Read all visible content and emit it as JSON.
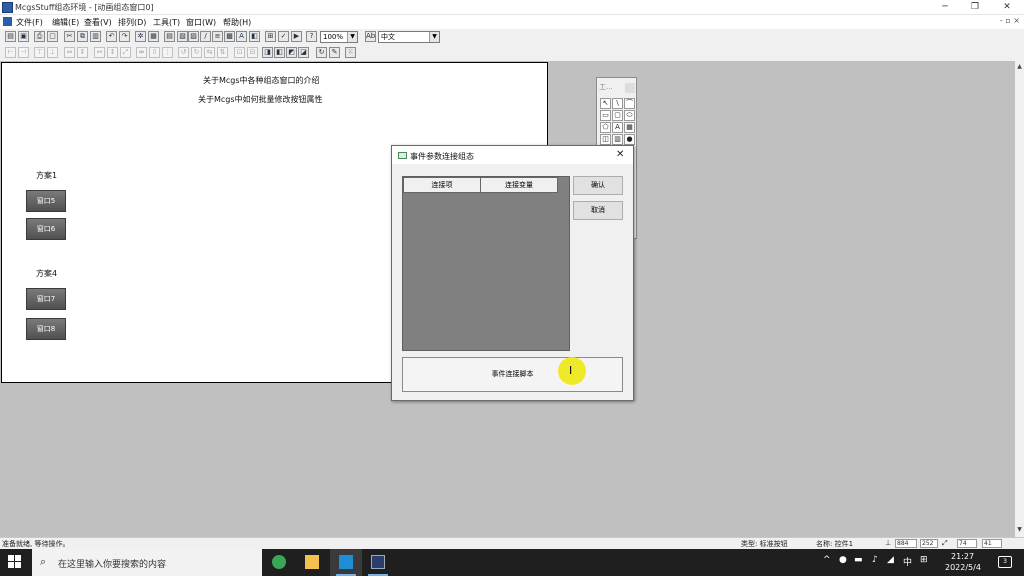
{
  "app": {
    "title": "McgsStuff组态环境 - [动画组态窗口0]",
    "minimize_glyph": "─",
    "maximize_glyph": "❐",
    "close_glyph": "✕"
  },
  "menu": {
    "items": [
      "文件(F)",
      "编辑(E)",
      "查看(V)",
      "排列(D)",
      "工具(T)",
      "窗口(W)",
      "帮助(H)"
    ],
    "mdi_controls": "- ▫ ×"
  },
  "toolbar": {
    "zoom_value": "100%",
    "font_combo_value": "中文"
  },
  "canvas": {
    "intro_line1": "关于Mcgs中各种组态窗口的介绍",
    "intro_line2": "关于Mcgs中如何批量修改按钮属性",
    "scheme1_label": "方案1",
    "scheme4_label": "方案4",
    "buttons": [
      "窗口5",
      "窗口6",
      "窗口7",
      "窗口8"
    ]
  },
  "toolbox": {
    "title": "工..."
  },
  "dialog": {
    "title": "事件参数连接组态",
    "close_glyph": "✕",
    "col_connection": "连接项",
    "col_variable": "连接变量",
    "ok_label": "确认",
    "cancel_label": "取消",
    "wide_button_label": "事件连接脚本"
  },
  "status": {
    "left": "准备就绪, 等待操作。",
    "type": "类型: 标准按钮",
    "name": "名称: 控件1",
    "coord_x": "884",
    "coord_y": "252",
    "coord_w": "74",
    "coord_h": "41"
  },
  "taskbar": {
    "search_placeholder": "在这里输入你要搜索的内容",
    "ime": "中",
    "time": "21:27",
    "date": "2022/5/4",
    "notification_count": "3"
  },
  "colors": {
    "workspace": "#c0c0c0",
    "list_body": "#808080",
    "cursor_highlight": "#f0e814",
    "taskbar": "#1f1f1f"
  }
}
